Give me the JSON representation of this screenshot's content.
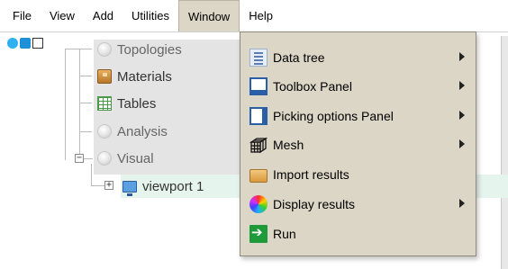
{
  "menubar": {
    "items": [
      {
        "label": "File",
        "active": false
      },
      {
        "label": "View",
        "active": false
      },
      {
        "label": "Add",
        "active": false
      },
      {
        "label": "Utilities",
        "active": false
      },
      {
        "label": "Window",
        "active": true
      },
      {
        "label": "Help",
        "active": false
      }
    ]
  },
  "tree": {
    "items": [
      {
        "label": "Topologies",
        "icon": "orb-icon",
        "dim": true
      },
      {
        "label": "Materials",
        "icon": "box-icon",
        "dim": false
      },
      {
        "label": "Tables",
        "icon": "table-icon",
        "dim": false
      },
      {
        "label": "Analysis",
        "icon": "orb-icon",
        "dim": true
      },
      {
        "label": "Visual",
        "icon": "orb-icon",
        "dim": true
      },
      {
        "label": "viewport 1",
        "icon": "monitor-icon",
        "dim": false
      }
    ],
    "expander_collapsed": "+",
    "expander_expanded": "−"
  },
  "window_menu": {
    "items": [
      {
        "label": "Data tree",
        "icon": "data-tree-icon",
        "submenu": true
      },
      {
        "label": "Toolbox Panel",
        "icon": "toolbox-panel-icon",
        "submenu": true
      },
      {
        "label": "Picking options Panel",
        "icon": "picking-panel-icon",
        "submenu": true
      },
      {
        "label": "Mesh",
        "icon": "mesh-icon",
        "submenu": true
      },
      {
        "label": "Import results",
        "icon": "import-results-icon",
        "submenu": false
      },
      {
        "label": "Display results",
        "icon": "display-results-icon",
        "submenu": true
      },
      {
        "label": "Run",
        "icon": "run-icon",
        "submenu": false
      }
    ]
  },
  "colors": {
    "menu_bg": "#dcd6c6",
    "selection_bg": "#e6f4ee",
    "tree_bg": "#e4e4e4",
    "accent_blue": "#2a5fa8"
  }
}
